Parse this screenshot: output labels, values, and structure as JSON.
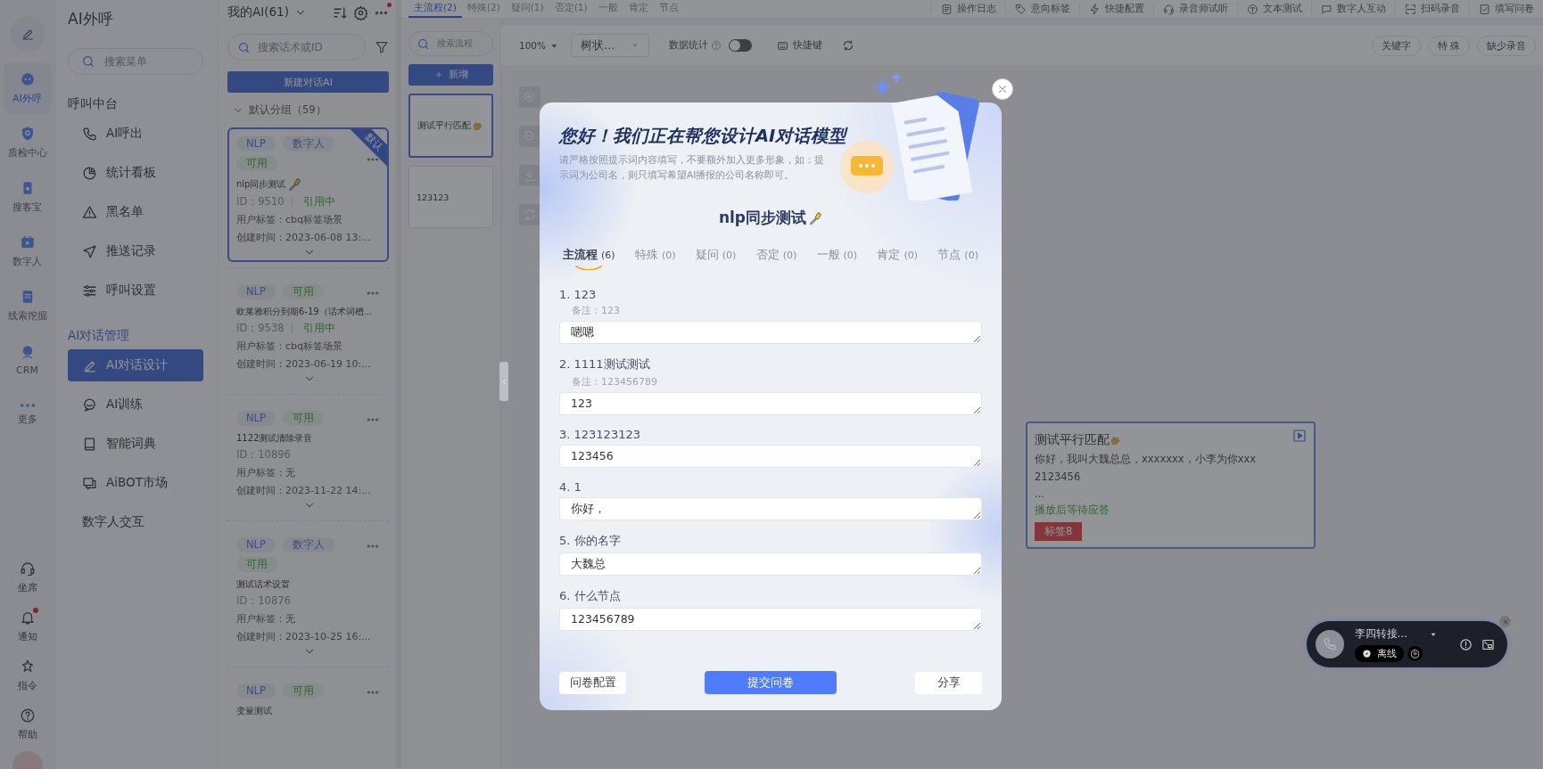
{
  "rail": {
    "items": [
      {
        "label": "AI外呼",
        "selected": true
      },
      {
        "label": "质检中心",
        "selected": false
      },
      {
        "label": "搜客宝",
        "selected": false
      },
      {
        "label": "数字人",
        "selected": false
      },
      {
        "label": "线索挖掘",
        "selected": false
      },
      {
        "label": "CRM",
        "selected": false
      },
      {
        "label": "更多",
        "selected": false
      }
    ],
    "bottom": [
      {
        "label": "坐席",
        "badge": false
      },
      {
        "label": "通知",
        "badge": true
      },
      {
        "label": "指令",
        "badge": false
      },
      {
        "label": "帮助",
        "badge": false
      }
    ]
  },
  "menu": {
    "title": "AI外呼",
    "search_placeholder": "搜索菜单",
    "sections": [
      {
        "title": "呼叫中台",
        "active": false,
        "items": [
          {
            "label": "AI呼出",
            "selected": false
          },
          {
            "label": "统计看板",
            "selected": false
          },
          {
            "label": "黑名单",
            "selected": false
          },
          {
            "label": "推送记录",
            "selected": false
          },
          {
            "label": "呼叫设置",
            "selected": false
          }
        ]
      },
      {
        "title": "AI对话管理",
        "active": true,
        "items": [
          {
            "label": "AI对话设计",
            "selected": true
          },
          {
            "label": "AI训练",
            "selected": false
          },
          {
            "label": "智能词典",
            "selected": false
          },
          {
            "label": "AiBOT市场",
            "selected": false
          }
        ]
      },
      {
        "title": "数字人交互",
        "active": false
      }
    ]
  },
  "ai_list": {
    "title": "我的AI(61)",
    "more_badge": true,
    "search_placeholder": "搜索话术或ID",
    "new_button": "新建对话AI",
    "group": "默认分组（59）",
    "cards": [
      {
        "tags": [
          {
            "label": "NLP",
            "kind": "type"
          },
          {
            "label": "数字人",
            "kind": "type"
          },
          {
            "label": "可用",
            "kind": "status"
          }
        ],
        "corner_badge": "默认",
        "name": "nlp同步测试",
        "name_icon": true,
        "id": "ID：9510",
        "usage": "引用中",
        "user_tag": "用户标签：cbq标签场景",
        "created": "创建时间：2023-06-08 13:...",
        "selected": true
      },
      {
        "tags": [
          {
            "label": "NLP",
            "kind": "type"
          },
          {
            "label": "可用",
            "kind": "status"
          }
        ],
        "name": "欧莱雅积分到期6-19（话术词槽...",
        "name_icon": false,
        "id": "ID：9538",
        "usage": "引用中",
        "user_tag": "用户标签：cbq标签场景",
        "created": "创建时间：2023-06-19 10:...",
        "selected": false
      },
      {
        "tags": [
          {
            "label": "NLP",
            "kind": "type"
          },
          {
            "label": "可用",
            "kind": "status"
          }
        ],
        "name": "1122测试清除录音",
        "name_icon": false,
        "id": "ID：10896",
        "user_tag": "用户标签：无",
        "created": "创建时间：2023-11-22 14:...",
        "selected": false
      },
      {
        "tags": [
          {
            "label": "NLP",
            "kind": "type"
          },
          {
            "label": "数字人",
            "kind": "type"
          },
          {
            "label": "可用",
            "kind": "status"
          }
        ],
        "name": "测试话术设置",
        "name_icon": false,
        "id": "ID：10876",
        "user_tag": "用户标签：无",
        "created": "创建时间：2023-10-25 16:...",
        "selected": false
      },
      {
        "tags": [
          {
            "label": "NLP",
            "kind": "type"
          },
          {
            "label": "可用",
            "kind": "status"
          }
        ],
        "name": "变量测试",
        "name_icon": false,
        "selected": false
      }
    ]
  },
  "top_tabs": [
    {
      "label": "主流程(2)",
      "selected": true
    },
    {
      "label": "特殊(2)",
      "selected": false
    },
    {
      "label": "疑问(1)",
      "selected": false
    },
    {
      "label": "否定(1)",
      "selected": false
    },
    {
      "label": "一般",
      "selected": false
    },
    {
      "label": "肯定",
      "selected": false
    },
    {
      "label": "节点",
      "selected": false
    }
  ],
  "top_actions": [
    "操作日志",
    "意向标签",
    "快捷配置",
    "录音师试听",
    "文本测试",
    "数字人互动",
    "扫码录音",
    "填写问卷"
  ],
  "flow_panel": {
    "search_placeholder": "搜索流程",
    "add_button": "新增",
    "flows": [
      {
        "name": "测试平行匹配",
        "name_icon": true,
        "selected": true
      },
      {
        "name": "123123",
        "name_icon": false,
        "selected": false
      }
    ]
  },
  "canvas": {
    "zoom": "100%",
    "layout": "树状...",
    "stats_label": "数据统计",
    "stats_on": false,
    "shortcut": "快捷键",
    "filters": [
      "关键字",
      "特 殊",
      "缺少录音"
    ],
    "node": {
      "title": "测试平行匹配",
      "title_icon": true,
      "lines": [
        "你好，我叫大魏总总，xxxxxxx，小李为你xxx",
        "2123456",
        "..."
      ],
      "wait_status": "播放后等待应答",
      "tag": "标签8"
    }
  },
  "modal": {
    "heading": "您好！我们正在帮您设计AI对话模型",
    "hint": "请严格按照提示词内容填写，不要额外加入更多形象，如：提示词为公司名，则只填写希望AI播报的公司名称即可。",
    "title": "nlp同步测试",
    "title_icon": true,
    "tabs": [
      {
        "label": "主流程",
        "count": "(6)",
        "selected": true
      },
      {
        "label": "特殊",
        "count": "(0)",
        "selected": false
      },
      {
        "label": "疑问",
        "count": "(0)",
        "selected": false
      },
      {
        "label": "否定",
        "count": "(0)",
        "selected": false
      },
      {
        "label": "一般",
        "count": "(0)",
        "selected": false
      },
      {
        "label": "肯定",
        "count": "(0)",
        "selected": false
      },
      {
        "label": "节点",
        "count": "(0)",
        "selected": false
      }
    ],
    "questions": [
      {
        "label": "1. 123",
        "note": "备注：123",
        "value": "嗯嗯"
      },
      {
        "label": "2. 1111测试测试",
        "note": "备注：123456789",
        "value": "123"
      },
      {
        "label": "3. 123123123",
        "value": "123456"
      },
      {
        "label": "4. 1",
        "value": "你好，"
      },
      {
        "label": "5. 你的名字",
        "value": "大魏总"
      },
      {
        "label": "6. 什么节点",
        "value": "123456789"
      }
    ],
    "buttons": [
      {
        "label": "问卷配置",
        "kind": "secondary"
      },
      {
        "label": "提交问卷",
        "kind": "primary"
      },
      {
        "label": "分享",
        "kind": "secondary"
      }
    ]
  },
  "call_widget": {
    "name": "李四转接...",
    "status": "离线"
  }
}
